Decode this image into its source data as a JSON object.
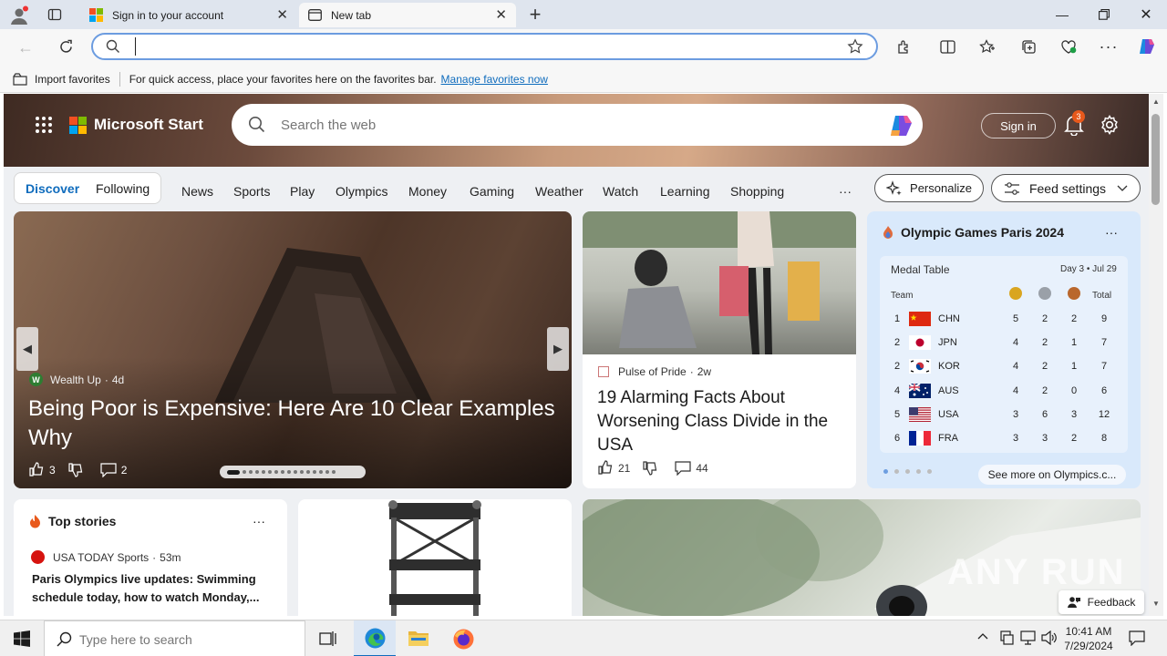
{
  "browser": {
    "tabs": [
      {
        "label": "Sign in to your account"
      },
      {
        "label": "New tab"
      }
    ],
    "address_value": "",
    "favorites_bar": {
      "import_label": "Import favorites",
      "hint": "For quick access, place your favorites here on the favorites bar.",
      "manage_link": "Manage favorites now"
    }
  },
  "msn": {
    "brand": "Microsoft Start",
    "search_placeholder": "Search the web",
    "sign_in": "Sign in",
    "notification_count": "3",
    "nav": {
      "discover": "Discover",
      "following": "Following",
      "items": [
        "News",
        "Sports",
        "Play",
        "Olympics",
        "Money",
        "Gaming",
        "Weather",
        "Watch",
        "Learning",
        "Shopping"
      ],
      "more": "···",
      "personalize": "Personalize",
      "feed_settings": "Feed settings"
    },
    "hero_card": {
      "source": "Wealth Up",
      "age": "4d",
      "title": "Being Poor is Expensive: Here Are 10 Clear Examples Why",
      "likes": "3",
      "comments": "2",
      "carousel_index": 0,
      "carousel_total": 16
    },
    "story_card": {
      "source": "Pulse of Pride",
      "age": "2w",
      "title": "19 Alarming Facts About Worsening Class Divide in the USA",
      "likes": "21",
      "comments": "44"
    },
    "olympics": {
      "title": "Olympic Games Paris 2024",
      "table_title": "Medal Table",
      "day_info": "Day 3 • Jul 29",
      "col_team": "Team",
      "col_total": "Total",
      "rows": [
        {
          "rank": "1",
          "team": "CHN",
          "gold": "5",
          "silver": "2",
          "bronze": "2",
          "total": "9"
        },
        {
          "rank": "2",
          "team": "JPN",
          "gold": "4",
          "silver": "2",
          "bronze": "1",
          "total": "7"
        },
        {
          "rank": "2",
          "team": "KOR",
          "gold": "4",
          "silver": "2",
          "bronze": "1",
          "total": "7"
        },
        {
          "rank": "4",
          "team": "AUS",
          "gold": "4",
          "silver": "2",
          "bronze": "0",
          "total": "6"
        },
        {
          "rank": "5",
          "team": "USA",
          "gold": "3",
          "silver": "6",
          "bronze": "3",
          "total": "12"
        },
        {
          "rank": "6",
          "team": "FRA",
          "gold": "3",
          "silver": "3",
          "bronze": "2",
          "total": "8"
        }
      ],
      "see_more": "See more on Olympics.c..."
    },
    "top_stories": {
      "title": "Top stories",
      "source": "USA TODAY Sports",
      "age": "53m",
      "headline": "Paris Olympics live updates: Swimming schedule today, how to watch Monday,..."
    },
    "feedback": "Feedback",
    "watermark": "ANY RUN"
  },
  "taskbar": {
    "search_placeholder": "Type here to search",
    "time": "10:41 AM",
    "date": "7/29/2024"
  },
  "colors": {
    "accent": "#0f6cbd",
    "tabbar": "#dfe5ee",
    "olympics_bg": "#d9e9fb",
    "notify": "#e8591c"
  }
}
